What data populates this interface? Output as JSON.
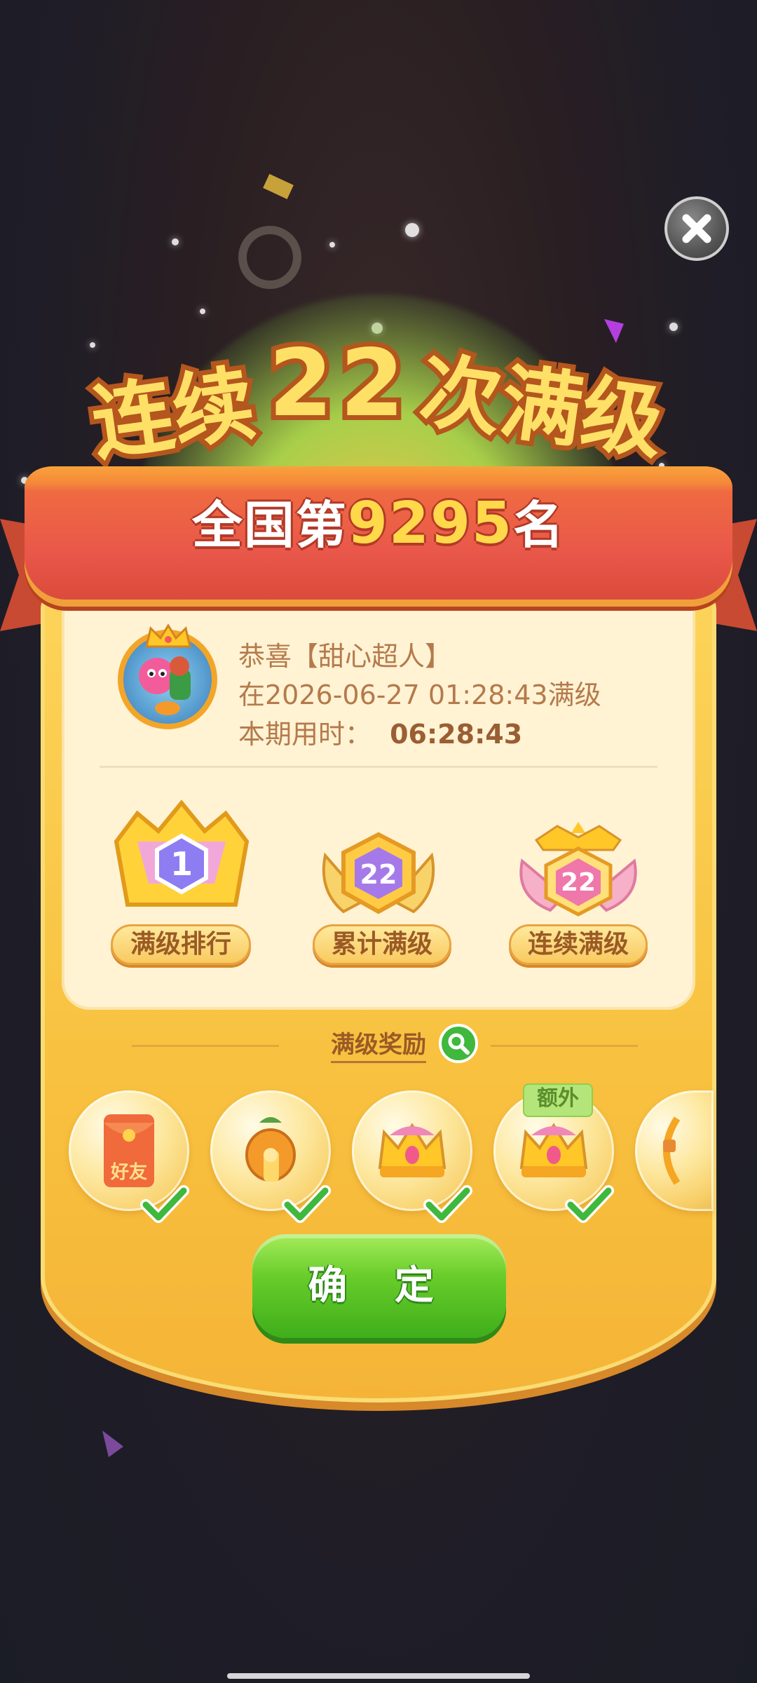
{
  "title": {
    "prefix": "连续",
    "number": "22",
    "suffix": "次满级"
  },
  "rank": {
    "prefix": "全国第",
    "number": "9295",
    "suffix": "名"
  },
  "player": {
    "congrats_line": "恭喜【甜心超人】",
    "achieved_line": "在2026-06-27 01:28:43满级",
    "time_label": "本期用时：",
    "time_value": "06:28:43"
  },
  "badges": [
    {
      "number": "1",
      "label": "满级排行",
      "color": "#9b7af0"
    },
    {
      "number": "22",
      "label": "累计满级",
      "color": "#b88bf5"
    },
    {
      "number": "22",
      "label": "连续满级",
      "color": "#f06aa0"
    }
  ],
  "rewards": {
    "title": "满级奖励",
    "items": [
      {
        "icon": "red-envelope-icon",
        "text": "好友",
        "claimed": true
      },
      {
        "icon": "trophy-vase-icon",
        "claimed": true
      },
      {
        "icon": "crown-icon",
        "claimed": true
      },
      {
        "icon": "crown-icon",
        "claimed": true,
        "tag": "额外"
      },
      {
        "icon": "partial-reward-icon",
        "claimed": false
      }
    ]
  },
  "confirm_label": "确 定",
  "colors": {
    "ribbon": "#e9584a",
    "card": "#f8c13f",
    "confirm": "#69cd2b",
    "accent_number": "#ffd94a"
  }
}
